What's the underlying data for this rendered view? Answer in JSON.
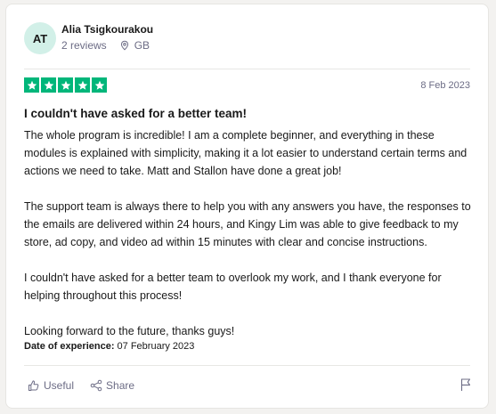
{
  "reviewer": {
    "initials": "AT",
    "name": "Alia Tsigkourakou",
    "review_count": "2 reviews",
    "country": "GB",
    "avatar_color": "#d2f0e8"
  },
  "review": {
    "rating": 5,
    "star_color": "#00b67a",
    "date": "8 Feb 2023",
    "title": "I couldn't have asked for a better team!",
    "paragraphs": [
      "The whole program is incredible! I am a complete beginner, and everything in these modules is explained with simplicity, making it a lot easier to understand certain terms and actions we need to take. Matt and Stallon have done a great job!",
      "The support team is always there to help you with any answers you have, the responses to the emails are delivered within 24 hours, and Kingy Lim was able to give feedback to my store, ad copy, and video ad within 15 minutes with clear and concise instructions.",
      "I couldn't have asked for a better team to overlook my work, and I thank everyone for helping throughout this process!",
      "Looking forward to the future, thanks guys!"
    ],
    "experience_label": "Date of experience:",
    "experience_date": "07 February 2023"
  },
  "actions": {
    "useful_label": "Useful",
    "share_label": "Share",
    "icons": [
      "thumbs-up-icon",
      "share-icon",
      "flag-icon",
      "location-pin-icon",
      "star-icon"
    ]
  }
}
